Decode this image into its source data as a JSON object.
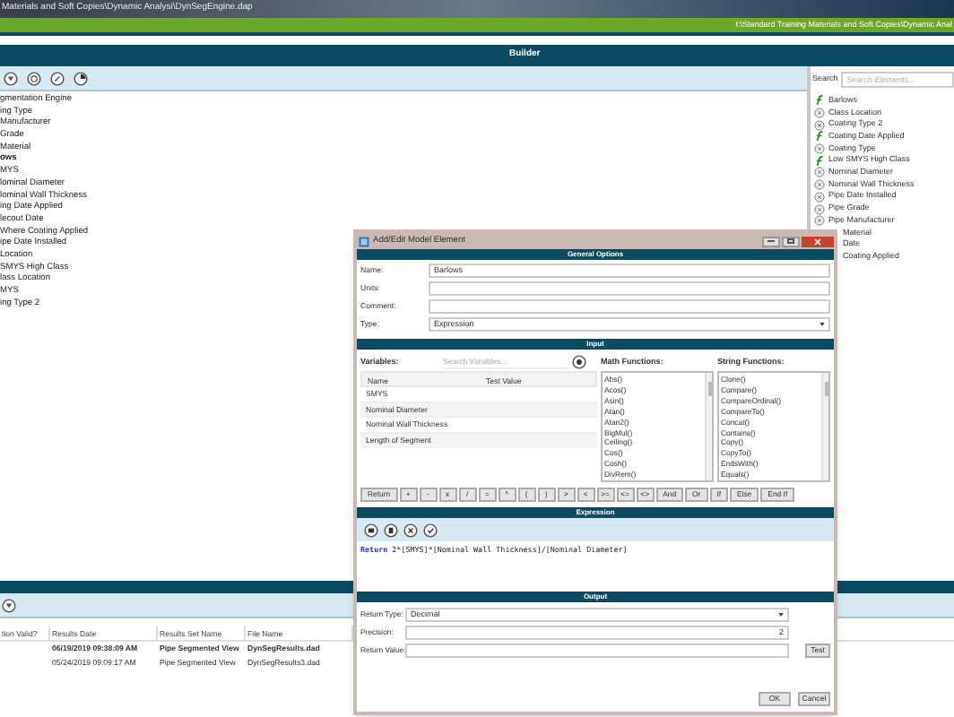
{
  "title_bar": {
    "path": "Materials and Soft Copies\\Dynamic Analysi\\DynSegEngine.dap",
    "path_right": "I:\\Standard Training Materials and Soft Copies\\Dynamic Anal"
  },
  "header": {
    "title": "Builder"
  },
  "search": {
    "label": "Search",
    "placeholder": "Search Elements..."
  },
  "tree": [
    {
      "label": "gmentation Engine",
      "bold": false
    },
    {
      "label": "ing Type",
      "bold": false
    },
    {
      "label": "Manufacturer",
      "bold": false
    },
    {
      "label": "Grade",
      "bold": false
    },
    {
      "label": "Material",
      "bold": false
    },
    {
      "label": "ows",
      "bold": true
    },
    {
      "label": "MYS",
      "bold": false
    },
    {
      "label": "lominal Diameter",
      "bold": false
    },
    {
      "label": "lominal Wall Thickness",
      "bold": false
    },
    {
      "label": "ing Date Applied",
      "bold": false
    },
    {
      "label": "lecout Date",
      "bold": false
    },
    {
      "label": "Where Coating Applied",
      "bold": false
    },
    {
      "label": "ipe Date Installed",
      "bold": false
    },
    {
      "label": "Location",
      "bold": false
    },
    {
      "label": "SMYS High Class",
      "bold": false
    },
    {
      "label": "lass Location",
      "bold": false
    },
    {
      "label": "MYS",
      "bold": false
    },
    {
      "label": "ing  Type 2",
      "bold": false
    }
  ],
  "elements": [
    {
      "label": "Barlows",
      "kind": "function"
    },
    {
      "label": "Class Location",
      "kind": "variable"
    },
    {
      "label": "Coating  Type 2",
      "kind": "variable"
    },
    {
      "label": "Coating Date Applied",
      "kind": "function"
    },
    {
      "label": "Coating Type",
      "kind": "variable"
    },
    {
      "label": "Low SMYS High Class",
      "kind": "function"
    },
    {
      "label": "Nominal Diameter",
      "kind": "variable"
    },
    {
      "label": "Nominal Wall Thickness",
      "kind": "variable"
    },
    {
      "label": "Pipe Date Installed",
      "kind": "variable"
    },
    {
      "label": "Pipe Grade",
      "kind": "variable"
    },
    {
      "label": "Pipe Manufacturer",
      "kind": "variable"
    },
    {
      "label": "Material",
      "kind": "partial"
    },
    {
      "label": "Date",
      "kind": "partial"
    },
    {
      "label": "Coating Applied",
      "kind": "partial"
    }
  ],
  "results": {
    "columns": [
      "tion Valid?",
      "Results Date",
      "Results Set Name",
      "File Name"
    ],
    "rows": [
      {
        "cells": [
          "",
          "06/19/2019 09:38:09 AM",
          "Pipe Segmented View",
          "DynSegResults.dad"
        ],
        "bold": true
      },
      {
        "cells": [
          "",
          "05/24/2019 09:09:17 AM",
          "Pipe Segmented View",
          "DynSegResults3.dad"
        ],
        "bold": false
      }
    ]
  },
  "dialog": {
    "title": "Add/Edit Model Element",
    "general": {
      "heading": "General Options",
      "fields": [
        {
          "label": "Name:",
          "value": "Barlows",
          "kind": "text"
        },
        {
          "label": "Units:",
          "kind": "text"
        },
        {
          "label": "Comment:",
          "kind": "text"
        },
        {
          "label": "Type:",
          "value": "Expression",
          "kind": "select"
        }
      ]
    },
    "input": {
      "heading": "Input",
      "variables_label": "Variables:",
      "variables_placeholder": "Search Variables...",
      "math_label": "Math Functions:",
      "string_label": "String Functions:",
      "variable_columns": [
        "Name",
        "Test Value"
      ],
      "variables": [
        "SMYS",
        "Nominal Diameter",
        "Nominal Wall Thickness",
        "Length of Segment"
      ],
      "math": [
        "Abs()",
        "Acos()",
        "Asin()",
        "Atan()",
        "Atan2()",
        "BigMul()",
        "Ceiling()",
        "Cos()",
        "Cosh()",
        "DivRem()"
      ],
      "string": [
        "Clone()",
        "Compare()",
        "CompareOrdinal()",
        "CompareTo()",
        "Concat()",
        "Contains()",
        "Copy()",
        "CopyTo()",
        "EndsWith()",
        "Equals()"
      ],
      "operators": [
        "Return",
        "+",
        "-",
        "x",
        "/",
        "=",
        "^",
        "(",
        ")",
        ">",
        "<",
        ">=",
        "<=",
        "<>",
        "And",
        "Or",
        "If",
        "Else",
        "End If"
      ]
    },
    "expression": {
      "heading": "Expression",
      "keyword": "Return",
      "code": " 2*[SMYS]*[Nominal Wall Thickness]/[Nominal Diameter]"
    },
    "output": {
      "heading": "Output",
      "fields": [
        {
          "label": "Return Type:",
          "value": "Decimal",
          "kind": "select"
        },
        {
          "label": "Precision:",
          "value": "2",
          "kind": "number"
        },
        {
          "label": "Return Value:",
          "kind": "test"
        }
      ],
      "test_button": "Test"
    },
    "buttons": [
      "OK",
      "Cancel"
    ]
  }
}
